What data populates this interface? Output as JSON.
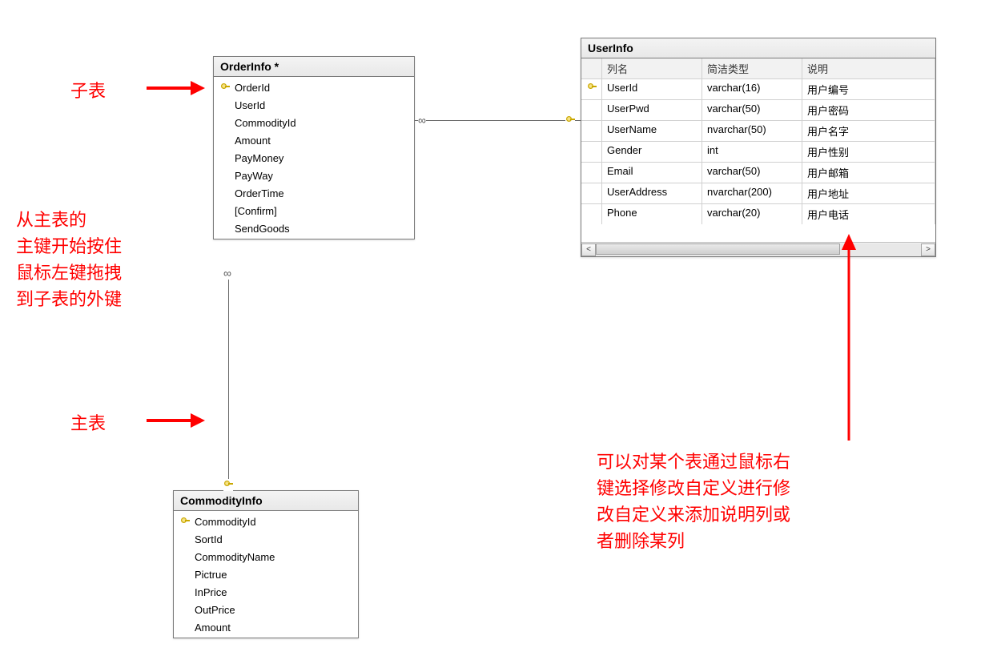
{
  "tables": {
    "orderinfo": {
      "title": "OrderInfo *",
      "fields": [
        {
          "pk": true,
          "name": "OrderId"
        },
        {
          "pk": false,
          "name": "UserId"
        },
        {
          "pk": false,
          "name": "CommodityId"
        },
        {
          "pk": false,
          "name": "Amount"
        },
        {
          "pk": false,
          "name": "PayMoney"
        },
        {
          "pk": false,
          "name": "PayWay"
        },
        {
          "pk": false,
          "name": "OrderTime"
        },
        {
          "pk": false,
          "name": "[Confirm]"
        },
        {
          "pk": false,
          "name": "SendGoods"
        }
      ]
    },
    "commodityinfo": {
      "title": "CommodityInfo",
      "fields": [
        {
          "pk": true,
          "name": "CommodityId"
        },
        {
          "pk": false,
          "name": "SortId"
        },
        {
          "pk": false,
          "name": "CommodityName"
        },
        {
          "pk": false,
          "name": "Pictrue"
        },
        {
          "pk": false,
          "name": "InPrice"
        },
        {
          "pk": false,
          "name": "OutPrice"
        },
        {
          "pk": false,
          "name": "Amount"
        }
      ]
    },
    "userinfo": {
      "title": "UserInfo",
      "headers": {
        "col1": "列名",
        "col2": "简洁类型",
        "col3": "说明"
      },
      "rows": [
        {
          "pk": true,
          "name": "UserId",
          "type": "varchar(16)",
          "desc": "用户编号"
        },
        {
          "pk": false,
          "name": "UserPwd",
          "type": "varchar(50)",
          "desc": "用户密码"
        },
        {
          "pk": false,
          "name": "UserName",
          "type": "nvarchar(50)",
          "desc": "用户名字"
        },
        {
          "pk": false,
          "name": "Gender",
          "type": "int",
          "desc": "用户性别"
        },
        {
          "pk": false,
          "name": "Email",
          "type": "varchar(50)",
          "desc": "用户邮箱"
        },
        {
          "pk": false,
          "name": "UserAddress",
          "type": "nvarchar(200)",
          "desc": "用户地址"
        },
        {
          "pk": false,
          "name": "Phone",
          "type": "varchar(20)",
          "desc": "用户电话"
        }
      ]
    }
  },
  "annotations": {
    "childTable": "子表",
    "mainTable": "主表",
    "dragHint": "从主表的\n主键开始按住\n鼠标左键拖拽\n到子表的外键",
    "rightClickHint": "可以对某个表通过鼠标右\n键选择修改自定义进行修\n改自定义来添加说明列或\n者删除某列"
  },
  "scrollbar": {
    "leftGlyph": "<",
    "rightGlyph": ">"
  }
}
